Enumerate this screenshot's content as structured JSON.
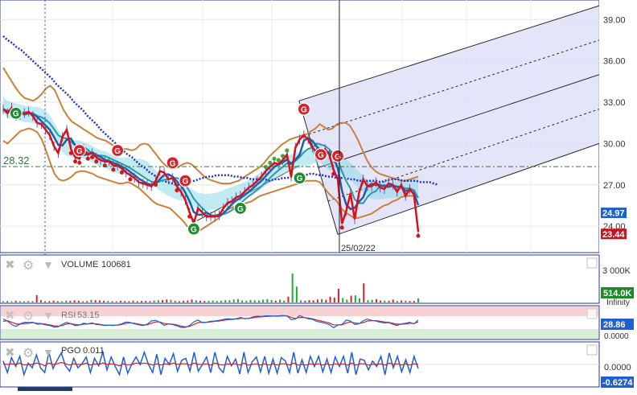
{
  "chart_data": [
    {
      "type": "line",
      "panel": "price",
      "price_axis_ticks": [
        "39.00",
        "36.00",
        "33.00",
        "30.00",
        "27.00",
        "24.00"
      ],
      "ylim": [
        22.2,
        40.3
      ],
      "grid": true,
      "horizontal_level": {
        "label": "28.32",
        "value": 28.32
      },
      "last_price_badges": [
        {
          "label": "24.97",
          "value": 24.97,
          "color": "#1f5fd4"
        },
        {
          "label": "23.44",
          "value": 23.44,
          "color": "#c8141e"
        }
      ],
      "crosshair_date_label": "25/02/22",
      "signal_markers": [
        {
          "label": "G",
          "kind": "buy",
          "index": 3,
          "value": 32.2
        },
        {
          "label": "G",
          "kind": "sell",
          "index": 18,
          "value": 29.5
        },
        {
          "label": "G",
          "kind": "sell",
          "index": 27,
          "value": 29.5
        },
        {
          "label": "G",
          "kind": "sell",
          "index": 40,
          "value": 28.6
        },
        {
          "label": "G",
          "kind": "sell",
          "index": 43,
          "value": 27.3
        },
        {
          "label": "G",
          "kind": "buy",
          "index": 45,
          "value": 23.8
        },
        {
          "label": "G",
          "kind": "buy",
          "index": 56,
          "value": 25.3
        },
        {
          "label": "G",
          "kind": "buy",
          "index": 70,
          "value": 27.5
        },
        {
          "label": "G",
          "kind": "sell",
          "index": 71,
          "value": 32.5
        },
        {
          "label": "G",
          "kind": "sell",
          "index": 75,
          "value": 29.2
        },
        {
          "label": "G",
          "kind": "sell",
          "index": 79,
          "value": 29.1
        }
      ],
      "close_series": [
        32.5,
        32.2,
        32.6,
        32.0,
        32.1,
        32.2,
        32.3,
        32.0,
        31.5,
        31.4,
        31.0,
        30.6,
        29.8,
        29.3,
        30.5,
        31.0,
        29.6,
        29.0,
        28.9,
        29.6,
        29.2,
        29.3,
        29.0,
        28.8,
        28.7,
        28.7,
        28.4,
        28.4,
        28.2,
        27.9,
        27.7,
        27.5,
        27.2,
        27.1,
        27.0,
        26.9,
        27.3,
        28.0,
        27.9,
        27.4,
        27.5,
        26.9,
        26.5,
        25.9,
        25.0,
        24.2,
        25.3,
        25.0,
        24.7,
        24.7,
        24.7,
        24.8,
        25.3,
        25.7,
        25.8,
        26.1,
        26.2,
        26.5,
        26.8,
        27.0,
        27.3,
        27.6,
        28.0,
        28.3,
        28.6,
        28.5,
        28.8,
        29.2,
        27.6,
        29.7,
        30.3,
        30.6,
        30.3,
        29.7,
        29.4,
        29.3,
        29.6,
        29.2,
        28.1,
        27.4,
        24.2,
        25.1,
        26.4,
        24.5,
        26.4,
        27.4,
        26.9,
        26.9,
        27.2,
        26.8,
        26.7,
        27.1,
        27.0,
        26.5,
        27.0,
        26.2,
        26.7,
        26.3,
        23.6
      ],
      "moving_average_long": [
        37.8,
        37.5,
        37.3,
        37.0,
        36.8,
        36.5,
        36.2,
        35.9,
        35.6,
        35.3,
        35.0,
        34.7,
        34.3,
        34.0,
        33.7,
        33.4,
        33.0,
        32.7,
        32.4,
        32.0,
        31.7,
        31.4,
        31.0,
        30.7,
        30.4,
        30.1,
        29.8,
        29.5,
        29.2,
        29.0,
        28.7,
        28.4,
        28.2,
        27.9,
        27.7,
        27.5,
        27.3,
        27.2,
        27.1,
        27.0,
        27.0,
        27.1,
        27.2,
        27.3,
        27.4,
        27.5,
        27.6,
        27.6,
        27.7,
        27.7,
        27.7,
        27.7,
        27.6,
        27.6,
        27.5,
        27.5,
        27.4,
        27.4,
        27.4,
        27.4,
        27.3,
        27.4,
        27.4,
        27.5,
        27.5,
        27.6,
        27.7,
        27.7,
        27.7,
        27.8,
        27.8,
        27.7,
        27.7,
        27.6,
        27.6,
        27.5,
        27.5,
        27.5,
        27.4,
        27.4,
        27.3,
        27.3,
        27.3,
        27.3,
        27.3,
        27.2,
        27.3,
        27.4,
        27.4,
        27.4,
        27.3,
        27.3,
        27.3,
        27.3,
        27.2,
        27.2,
        27.2,
        27.1,
        27.0
      ],
      "bollinger_upper": [
        35.5,
        35.0,
        34.5,
        34.0,
        33.6,
        33.3,
        33.2,
        33.1,
        33.3,
        33.6,
        34.0,
        34.2,
        33.9,
        33.2,
        32.5,
        32.0,
        31.6,
        31.4,
        31.2,
        31.0,
        30.8,
        30.6,
        30.4,
        30.3,
        30.2,
        30.0,
        29.8,
        29.7,
        29.6,
        29.6,
        29.5,
        29.6,
        29.9,
        30.0,
        29.9,
        29.5,
        29.1,
        28.7,
        28.4,
        28.2,
        28.2,
        28.3,
        28.5,
        28.6,
        28.5,
        28.2,
        27.9,
        27.6,
        27.4,
        27.3,
        27.2,
        27.1,
        27.1,
        27.1,
        27.2,
        27.3,
        27.5,
        27.7,
        27.9,
        28.1,
        28.3,
        28.6,
        29.0,
        29.3,
        29.6,
        29.9,
        30.1,
        30.3,
        30.4,
        30.5,
        30.6,
        30.7,
        30.9,
        31.1,
        31.4,
        31.2,
        31.0,
        31.1,
        31.4,
        31.5,
        31.5,
        31.3,
        30.8,
        30.2,
        29.5,
        28.8,
        28.3,
        28.0,
        27.8,
        27.7,
        27.6,
        27.5,
        27.4,
        27.3,
        27.3,
        27.4,
        27.5,
        27.6
      ],
      "bollinger_lower": [
        30.2,
        30.0,
        30.3,
        30.6,
        30.9,
        31.0,
        31.1,
        31.0,
        30.8,
        30.3,
        29.5,
        28.6,
        27.8,
        27.4,
        27.3,
        27.4,
        27.6,
        27.9,
        28.0,
        28.0,
        27.9,
        27.8,
        27.6,
        27.5,
        27.4,
        27.3,
        27.2,
        27.1,
        27.1,
        27.2,
        27.1,
        26.9,
        26.7,
        26.4,
        26.1,
        25.8,
        25.6,
        25.5,
        25.4,
        25.3,
        25.0,
        24.7,
        24.4,
        24.0,
        23.7,
        23.6,
        23.7,
        23.9,
        24.1,
        24.3,
        24.5,
        24.8,
        25.1,
        25.3,
        25.4,
        25.5,
        25.6,
        25.7,
        25.8,
        26.0,
        26.2,
        26.3,
        26.4,
        26.5,
        26.6,
        26.7,
        26.8,
        26.9,
        27.0,
        27.1,
        27.2,
        27.3,
        27.3,
        27.3,
        27.2,
        26.8,
        26.4,
        26.1,
        25.8,
        25.3,
        25.0,
        24.8,
        24.6,
        24.6,
        24.7,
        24.8,
        24.9,
        25.1,
        25.3,
        25.5,
        25.6,
        25.8,
        25.9,
        26.1,
        26.2,
        26.2,
        26.2,
        26.2
      ],
      "pitchfork_anchor_dates_index": [
        71,
        79,
        98
      ],
      "pitchfork_channel": {
        "upper_start": 33.1,
        "upper_end": 40.0,
        "lower_start": 23.4,
        "lower_end": 30.0
      }
    },
    {
      "type": "bar",
      "panel": "volume",
      "title": "VOLUME",
      "value_label": "100681",
      "axis_top_label": "3 000K",
      "badge": {
        "label": "514.0K",
        "color": "#1f8a2a"
      },
      "footer_label": "Infinity",
      "ylim": [
        0,
        3000
      ],
      "values": [
        40,
        55,
        30,
        70,
        45,
        35,
        60,
        50,
        300,
        95,
        40,
        55,
        75,
        45,
        50,
        80,
        65,
        90,
        70,
        40,
        55,
        110,
        95,
        85,
        70,
        60,
        50,
        45,
        65,
        55,
        40,
        75,
        50,
        60,
        65,
        55,
        80,
        95,
        100,
        125,
        110,
        60,
        50,
        70,
        80,
        120,
        90,
        75,
        60,
        70,
        80,
        65,
        70,
        95,
        90,
        120,
        140,
        85,
        70,
        110,
        90,
        80,
        120,
        140,
        100,
        75,
        115,
        80,
        240,
        1180,
        650,
        80,
        70,
        95,
        85,
        120,
        140,
        110,
        240,
        200,
        560,
        180,
        120,
        280,
        290,
        170,
        780,
        95,
        110,
        140,
        80,
        75,
        70,
        120,
        65,
        85,
        75,
        60,
        60,
        170
      ],
      "up_color": "#22aa33",
      "down_color": "#dd2222"
    },
    {
      "type": "line",
      "panel": "rsi",
      "title": "RSI",
      "value_label": "53.15",
      "axis_bottom_label": "0.0000",
      "badge": {
        "label": "28.86",
        "color": "#1f5fd4"
      },
      "ylim": [
        0,
        100
      ],
      "bands": {
        "overbought": 70,
        "oversold": 30
      },
      "rsi": [
        61,
        55,
        44,
        38,
        46,
        51,
        50,
        51,
        45,
        46,
        43,
        41,
        36,
        37,
        45,
        51,
        46,
        41,
        42,
        48,
        46,
        49,
        44,
        43,
        41,
        42,
        41,
        43,
        46,
        52,
        50,
        46,
        43,
        41,
        45,
        55,
        57,
        51,
        41,
        46,
        44,
        40,
        35,
        35,
        41,
        52,
        58,
        50,
        51,
        54,
        55,
        57,
        60,
        62,
        61,
        62,
        66,
        62,
        63,
        68,
        70,
        69,
        71,
        71,
        70,
        71,
        72,
        71,
        59,
        61,
        72,
        66,
        62,
        60,
        54,
        51,
        48,
        44,
        34,
        42,
        44,
        58,
        55,
        44,
        46,
        56,
        61,
        57,
        55,
        51,
        49,
        50,
        45,
        41,
        46,
        48,
        51,
        46,
        58
      ],
      "signal": [
        54,
        56,
        51,
        46,
        45,
        47,
        48,
        50,
        48,
        47,
        45,
        43,
        40,
        39,
        41,
        46,
        47,
        44,
        43,
        45,
        46,
        47,
        46,
        44,
        42,
        42,
        42,
        42,
        44,
        48,
        49,
        48,
        45,
        43,
        43,
        48,
        52,
        52,
        47,
        46,
        45,
        43,
        39,
        37,
        38,
        44,
        50,
        51,
        51,
        52,
        54,
        55,
        57,
        59,
        60,
        61,
        63,
        63,
        63,
        65,
        67,
        68,
        69,
        70,
        70,
        70,
        71,
        71,
        66,
        63,
        66,
        66,
        64,
        62,
        58,
        55,
        52,
        49,
        43,
        43,
        43,
        49,
        52,
        49,
        47,
        50,
        55,
        56,
        56,
        54,
        52,
        51,
        48,
        45,
        45,
        46,
        48,
        47,
        52
      ]
    },
    {
      "type": "line",
      "panel": "pgo",
      "title": "PGO",
      "value_label": "0.011",
      "axis_mid_label": "0.0000",
      "badge": {
        "label": "-0.6274",
        "color": "#1f5fd4"
      },
      "ylim": [
        -3.2,
        3.2
      ],
      "pgo": [
        0.5,
        -1.2,
        1.0,
        -0.3,
        1.2,
        -1.5,
        0.2,
        -0.5,
        1.4,
        -0.5,
        -1.2,
        1.8,
        -0.6,
        0.6,
        1.7,
        -0.2,
        -1.0,
        0.9,
        -0.5,
        0.1,
        1.1,
        -1.2,
        0.9,
        -0.2,
        1.8,
        -0.8,
        1.1,
        -0.3,
        -1.5,
        1.1,
        -1.3,
        0.1,
        1.1,
        0.0,
        1.8,
        0.0,
        -1.2,
        1.5,
        -1.5,
        0.9,
        0.0,
        1.6,
        -1.0,
        0.6,
        0.9,
        -1.0,
        1.8,
        -1.0,
        0.0,
        1.1,
        -1.2,
        1.8,
        -0.5,
        -1.2,
        1.2,
        -0.2,
        0.8,
        -1.4,
        1.8,
        -1.2,
        0.4,
        1.1,
        -1.1,
        1.2,
        -1.3,
        0.8,
        -1.3,
        1.0,
        0.5,
        -1.2,
        1.8,
        -1.3,
        0.7,
        -1.2,
        1.2,
        -0.3,
        1.2,
        -1.1,
        0.8,
        -1.2,
        1.1,
        -0.3,
        1.2,
        -1.3,
        1.8,
        -1.5,
        0.8,
        0.6,
        -0.8,
        0.5,
        -0.3,
        1.2,
        -1.5,
        1.7,
        -0.5,
        1.2,
        -1.1,
        0.7,
        -1.2,
        1.2,
        -0.6
      ],
      "signal": [
        0.1,
        0.0,
        0.1,
        0.0,
        0.2,
        -0.1,
        0.0,
        0.0,
        0.2,
        0.1,
        -0.2,
        0.2,
        0.0,
        0.1,
        0.3,
        0.1,
        -0.1,
        0.1,
        0.0,
        0.0,
        0.2,
        -0.1,
        0.1,
        0.0,
        0.2,
        0.0,
        0.1,
        0.0,
        -0.2,
        0.1,
        -0.1,
        0.0,
        0.2,
        0.1,
        0.2,
        0.1,
        -0.1,
        0.1,
        -0.1,
        0.1,
        0.0,
        0.2,
        0.0,
        0.1,
        0.1,
        -0.1,
        0.2,
        0.0,
        0.0,
        0.1,
        -0.1,
        0.2,
        0.0,
        -0.1,
        0.1,
        0.0,
        0.1,
        -0.1,
        0.2,
        -0.1,
        0.0,
        0.1,
        -0.1,
        0.1,
        -0.1,
        0.1,
        -0.1,
        0.1,
        0.1,
        -0.1,
        0.2,
        -0.1,
        0.0,
        -0.1,
        0.1,
        0.0,
        0.1,
        -0.1,
        0.1,
        -0.1,
        0.1,
        0.0,
        0.1,
        -0.1,
        0.2,
        -0.1,
        0.1,
        0.1,
        -0.1,
        0.0,
        0.0,
        0.1,
        -0.1,
        0.2,
        0.0,
        0.1,
        -0.1,
        0.1,
        -0.1,
        0.1,
        0.0
      ]
    }
  ],
  "toolbar": {
    "close_icon": "close-icon",
    "settings_icon": "gear-icon",
    "move_icon": "arrow-down-icon"
  },
  "colors": {
    "price_line": "#d9101a",
    "ma_blue": "#1a5fa8",
    "ma_long_dotted": "#2233cc",
    "bollinger": "#c8823c",
    "cloud": "#8fd8e8",
    "pitchfork_fill": "#dcdcf8",
    "buy_marker": "#1e8c2e",
    "sell_marker": "#d8202a"
  }
}
